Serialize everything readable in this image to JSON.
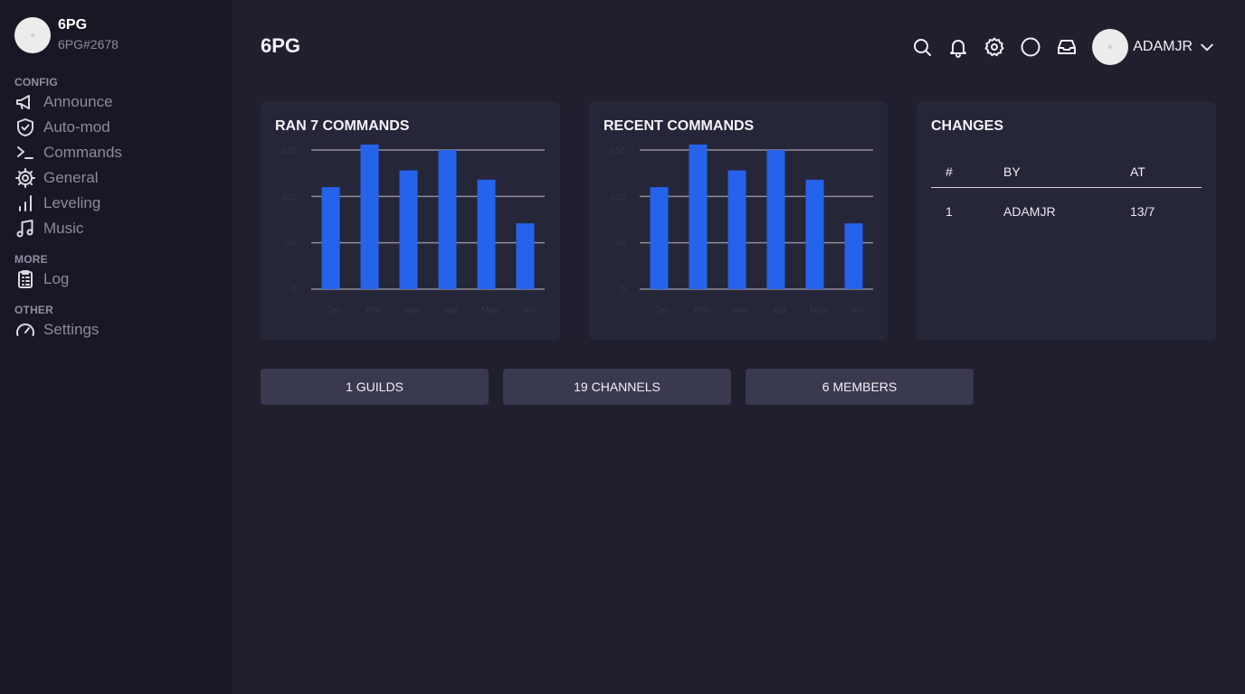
{
  "bot": {
    "name": "6PG",
    "tag": "6PG#2678"
  },
  "sidebar": {
    "sections": [
      {
        "title": "CONFIG",
        "items": [
          {
            "label": "Announce",
            "icon": "megaphone-icon"
          },
          {
            "label": "Auto-mod",
            "icon": "shield-check-icon"
          },
          {
            "label": "Commands",
            "icon": "terminal-icon"
          },
          {
            "label": "General",
            "icon": "cog-icon"
          },
          {
            "label": "Leveling",
            "icon": "bar-chart-icon"
          },
          {
            "label": "Music",
            "icon": "music-note-icon"
          }
        ]
      },
      {
        "title": "MORE",
        "items": [
          {
            "label": "Log",
            "icon": "clipboard-list-icon"
          }
        ]
      },
      {
        "title": "OTHER",
        "items": [
          {
            "label": "Settings",
            "icon": "gauge-icon"
          }
        ]
      }
    ]
  },
  "header": {
    "title": "6PG",
    "user": {
      "name": "ADAMJR"
    },
    "icons": [
      "search-icon",
      "bell-icon",
      "gear-icon",
      "circle-icon",
      "inbox-icon"
    ]
  },
  "cards": {
    "ran": {
      "title": "RAN 7 COMMANDS"
    },
    "recent": {
      "title": "RECENT COMMANDS"
    },
    "changes": {
      "title": "CHANGES",
      "headers": [
        "#",
        "BY",
        "AT"
      ],
      "rows": [
        {
          "num": "1",
          "by": "ADAMJR",
          "at": "13/7"
        }
      ]
    }
  },
  "chart_data": [
    {
      "type": "bar",
      "categories": [
        "Jan",
        "Feb",
        "Mar",
        "Apr",
        "May",
        "Jun"
      ],
      "values": [
        110,
        157,
        128,
        150,
        118,
        71
      ],
      "ylim": [
        0,
        150
      ],
      "yticks": [
        0,
        50,
        100,
        150
      ],
      "bar_color": "#2563eb",
      "grid": true
    },
    {
      "type": "bar",
      "categories": [
        "Jan",
        "Feb",
        "Mar",
        "Apr",
        "May",
        "Jun"
      ],
      "values": [
        110,
        157,
        128,
        150,
        118,
        71
      ],
      "ylim": [
        0,
        150
      ],
      "yticks": [
        0,
        50,
        100,
        150
      ],
      "bar_color": "#2563eb",
      "grid": true
    }
  ],
  "stats": {
    "guilds": "1 GUILDS",
    "channels": "19 CHANNELS",
    "members": "6 MEMBERS"
  }
}
